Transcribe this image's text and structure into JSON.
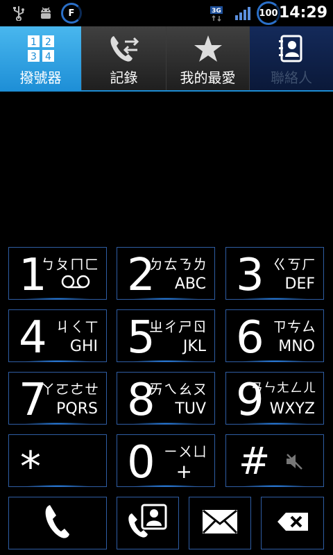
{
  "status_bar": {
    "time": "14:29",
    "battery_level": "100",
    "flash_badge": "F",
    "network_type": "3G",
    "icons": [
      "usb-icon",
      "android-debug-icon",
      "flash-icon",
      "3g-icon",
      "signal-icon",
      "battery-icon"
    ]
  },
  "tabs": [
    {
      "label": "撥號器",
      "icon": "dialpad-icon"
    },
    {
      "label": "記錄",
      "icon": "call-log-icon"
    },
    {
      "label": "我的最愛",
      "icon": "star-icon"
    },
    {
      "label": "聯絡人",
      "icon": "contacts-icon"
    }
  ],
  "keypad": {
    "keys": [
      {
        "digit": "1",
        "zhuyin": "ㄅㄆㄇㄈ",
        "letters": ""
      },
      {
        "digit": "2",
        "zhuyin": "ㄉㄊㄋㄌ",
        "letters": "ABC"
      },
      {
        "digit": "3",
        "zhuyin": "ㄍㄎㄏ",
        "letters": "DEF"
      },
      {
        "digit": "4",
        "zhuyin": "ㄐㄑㄒ",
        "letters": "GHI"
      },
      {
        "digit": "5",
        "zhuyin": "ㄓㄔㄕㄖ",
        "letters": "JKL"
      },
      {
        "digit": "6",
        "zhuyin": "ㄗㄘㄙ",
        "letters": "MNO"
      },
      {
        "digit": "7",
        "zhuyin": "ㄚㄛㄜㄝ",
        "letters": "PQRS"
      },
      {
        "digit": "8",
        "zhuyin": "ㄞㄟㄠㄡ",
        "letters": "TUV"
      },
      {
        "digit": "9",
        "zhuyin": "ㄢㄣㄤㄥㄦ",
        "letters": "WXYZ"
      },
      {
        "digit": "*",
        "zhuyin": "",
        "letters": ""
      },
      {
        "digit": "0",
        "zhuyin": "ㄧㄨㄩ",
        "letters": "+"
      },
      {
        "digit": "#",
        "zhuyin": "",
        "letters": ""
      }
    ]
  },
  "actions": {
    "call_icon": "phone-icon",
    "add_contact_icon": "add-contact-icon",
    "sms_icon": "envelope-icon",
    "delete_icon": "backspace-icon"
  },
  "colors": {
    "accent": "#1d8ed6",
    "key_border": "#2f5ea5",
    "glow": "#2a8fff"
  }
}
